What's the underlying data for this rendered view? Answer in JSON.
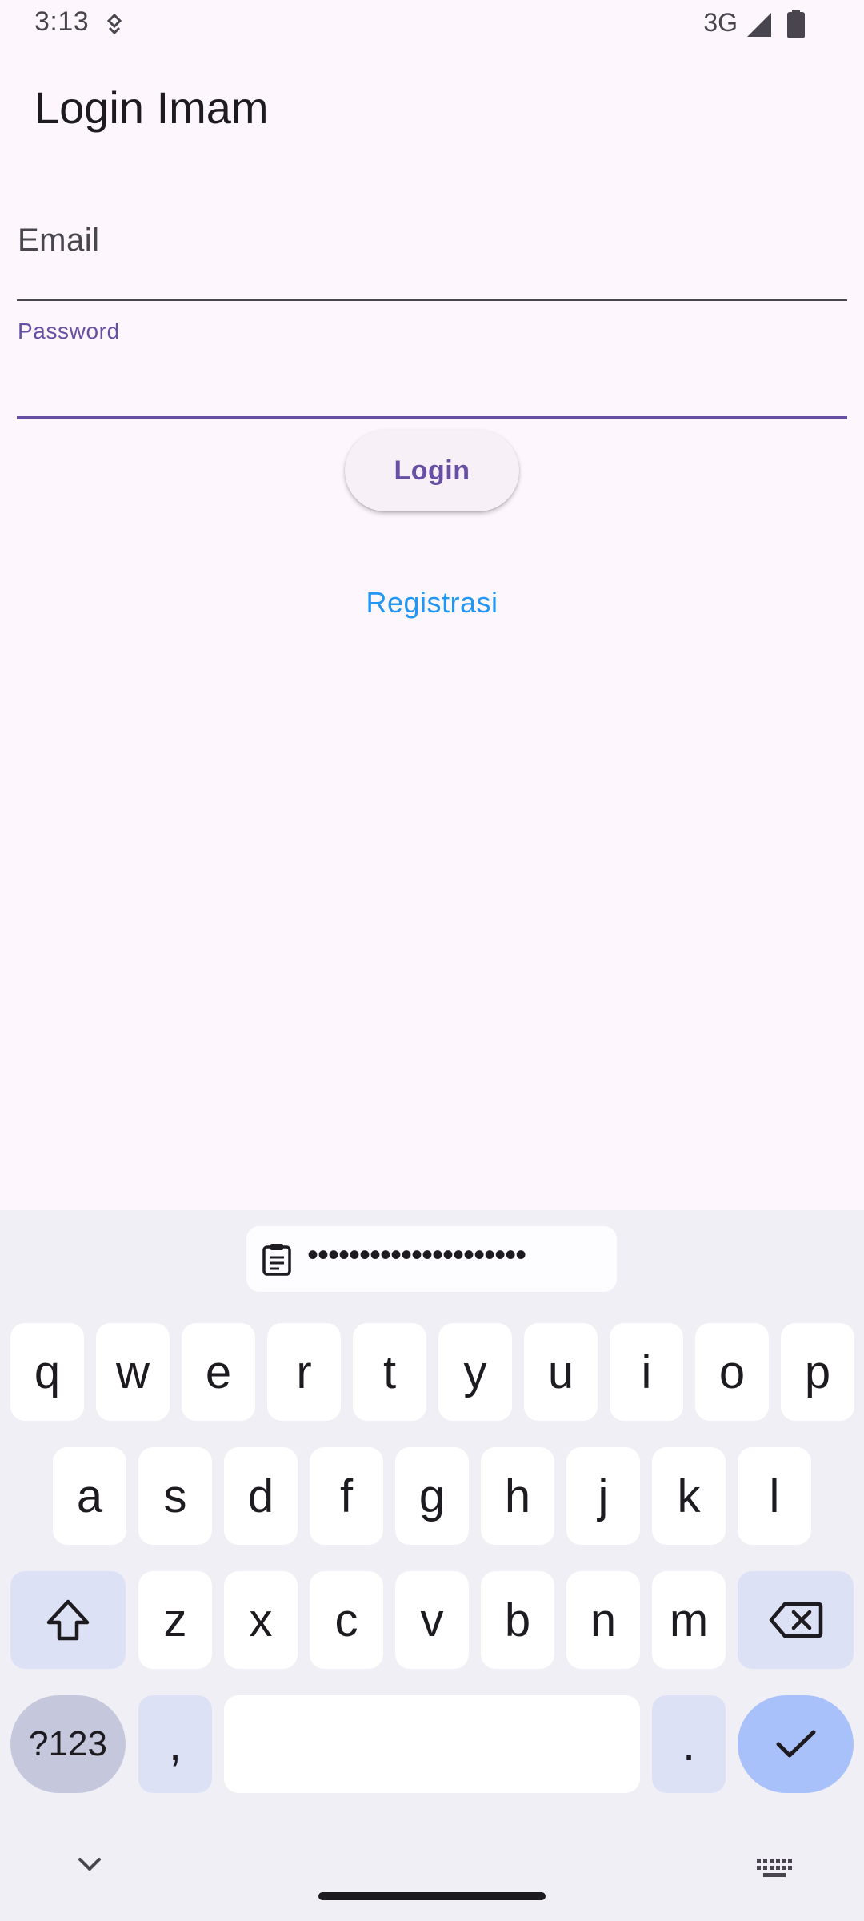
{
  "status_bar": {
    "time": "3:13",
    "network": "3G",
    "icons": [
      "app-notification-icon",
      "signal-icon",
      "battery-icon"
    ]
  },
  "app_bar": {
    "title": "Login Imam"
  },
  "form": {
    "email_label": "Email",
    "password_label": "Password",
    "password_value": ""
  },
  "actions": {
    "login_label": "Login",
    "register_label": "Registrasi"
  },
  "keyboard": {
    "clipboard_suggestion": "•••••••••••••••••••••",
    "row1": [
      "q",
      "w",
      "e",
      "r",
      "t",
      "y",
      "u",
      "i",
      "o",
      "p"
    ],
    "row2": [
      "a",
      "s",
      "d",
      "f",
      "g",
      "h",
      "j",
      "k",
      "l"
    ],
    "row3": [
      "z",
      "x",
      "c",
      "v",
      "b",
      "n",
      "m"
    ],
    "symbols_label": "?123",
    "comma_label": ",",
    "period_label": ".",
    "icons": [
      "shift-icon",
      "backspace-icon",
      "check-icon",
      "chevron-down-icon",
      "keyboard-icon",
      "clipboard-icon"
    ]
  },
  "colors": {
    "background": "#fdf7fd",
    "primary": "#6750a4",
    "link": "#2196f3",
    "keyboard_bg": "#f0eff5",
    "enter_key": "#a8c1fb"
  }
}
